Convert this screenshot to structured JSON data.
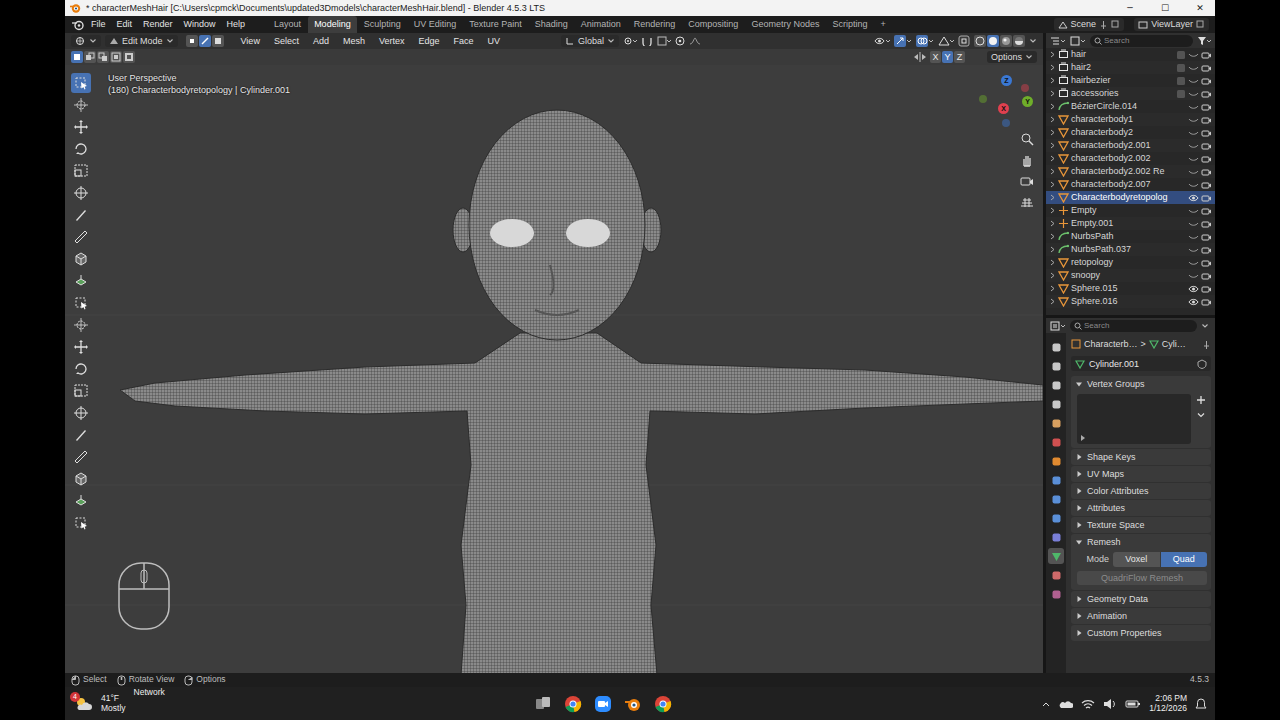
{
  "window": {
    "title": "* characterMeshHair [C:\\Users\\cpmck\\Documents\\updated3Dmodels\\characterMeshHair.blend] - Blender 4.5.3 LTS",
    "controls": [
      "─",
      "☐",
      "✕"
    ]
  },
  "menu": [
    "File",
    "Edit",
    "Render",
    "Window",
    "Help"
  ],
  "workspaces": [
    {
      "label": "Layout",
      "selected": false
    },
    {
      "label": "Modeling",
      "selected": true
    },
    {
      "label": "Sculpting",
      "selected": false
    },
    {
      "label": "UV Editing",
      "selected": false
    },
    {
      "label": "Texture Paint",
      "selected": false
    },
    {
      "label": "Shading",
      "selected": false
    },
    {
      "label": "Animation",
      "selected": false
    },
    {
      "label": "Rendering",
      "selected": false
    },
    {
      "label": "Compositing",
      "selected": false
    },
    {
      "label": "Geometry Nodes",
      "selected": false
    },
    {
      "label": "Scripting",
      "selected": false
    }
  ],
  "workspace_add": "+",
  "scene": "Scene",
  "view_layer": "ViewLayer",
  "header": {
    "mode": "Edit Mode",
    "select_modes": [
      {
        "selected": false
      },
      {
        "selected": true
      },
      {
        "selected": false
      }
    ],
    "menus": [
      "View",
      "Select",
      "Add",
      "Mesh",
      "Vertex",
      "Edge",
      "Face",
      "UV"
    ],
    "orientation": "Global",
    "shading": [
      {
        "selected": false
      },
      {
        "selected": true
      },
      {
        "selected": false
      },
      {
        "selected": false
      }
    ]
  },
  "tool_header": {
    "box_modes": [
      {
        "selected": true
      },
      {
        "selected": false
      },
      {
        "selected": false
      },
      {
        "selected": false
      },
      {
        "selected": false
      }
    ],
    "mirror": [
      {
        "label": "X",
        "selected": false
      },
      {
        "label": "Y",
        "selected": true
      },
      {
        "label": "Z",
        "selected": false
      }
    ],
    "options": "Options"
  },
  "toolbar": {
    "tools": [
      {
        "selected": true
      },
      {
        "selected": false
      },
      {
        "selected": false
      },
      {
        "selected": false
      },
      {
        "selected": false
      },
      {
        "selected": false
      },
      {
        "selected": false
      },
      {
        "selected": false
      },
      {
        "selected": false
      },
      {
        "selected": false
      },
      {
        "selected": false
      },
      {
        "selected": false
      },
      {
        "selected": false
      },
      {
        "selected": false
      },
      {
        "selected": false
      },
      {
        "selected": false
      },
      {
        "selected": false
      },
      {
        "selected": false
      },
      {
        "selected": false
      },
      {
        "selected": false
      },
      {
        "selected": false
      }
    ]
  },
  "viewport": {
    "view_name": "User Perspective",
    "object_info": "(180) Characterbodyretopology | Cylinder.001",
    "axes": [
      {
        "label": "X",
        "color": "#e0404f"
      },
      {
        "label": "Y",
        "color": "#6fae2a"
      },
      {
        "label": "Z",
        "color": "#3a78d4"
      }
    ]
  },
  "outliner": {
    "search_placeholder": "Search",
    "items": [
      {
        "name": "hair",
        "kind": "collection",
        "included": false,
        "visible": false,
        "selected": false
      },
      {
        "name": "hair2",
        "kind": "collection",
        "included": false,
        "visible": false,
        "selected": false
      },
      {
        "name": "hairbezier",
        "kind": "collection",
        "included": false,
        "visible": false,
        "selected": false
      },
      {
        "name": "accessories",
        "kind": "collection",
        "included": false,
        "visible": false,
        "selected": false
      },
      {
        "name": "BézierCircle.014",
        "kind": "curve",
        "visible": false,
        "selected": false
      },
      {
        "name": "characterbody1",
        "kind": "mesh",
        "visible": false,
        "selected": false
      },
      {
        "name": "characterbody2",
        "kind": "mesh",
        "visible": false,
        "selected": false
      },
      {
        "name": "characterbody2.001",
        "kind": "mesh",
        "visible": false,
        "selected": false
      },
      {
        "name": "characterbody2.002",
        "kind": "mesh",
        "visible": false,
        "selected": false
      },
      {
        "name": "characterbody2.002 Re",
        "kind": "mesh",
        "visible": false,
        "selected": false
      },
      {
        "name": "characterbody2.007",
        "kind": "mesh",
        "visible": false,
        "selected": false
      },
      {
        "name": "Characterbodyretopolog",
        "kind": "mesh",
        "visible": true,
        "selected": true
      },
      {
        "name": "Empty",
        "kind": "empty",
        "visible": false,
        "selected": false
      },
      {
        "name": "Empty.001",
        "kind": "empty",
        "visible": false,
        "selected": false
      },
      {
        "name": "NurbsPath",
        "kind": "curve",
        "visible": false,
        "selected": false
      },
      {
        "name": "NurbsPath.037",
        "kind": "curve",
        "visible": false,
        "selected": false
      },
      {
        "name": "retopology",
        "kind": "mesh",
        "visible": false,
        "selected": false
      },
      {
        "name": "snoopy",
        "kind": "mesh",
        "visible": false,
        "selected": false
      },
      {
        "name": "Sphere.015",
        "kind": "mesh",
        "visible": true,
        "selected": false
      },
      {
        "name": "Sphere.016",
        "kind": "mesh",
        "visible": true,
        "selected": false
      }
    ]
  },
  "properties": {
    "search_placeholder": "Search",
    "tabs": [
      {
        "selected": false
      },
      {
        "selected": false
      },
      {
        "selected": false
      },
      {
        "selected": false
      },
      {
        "selected": false
      },
      {
        "selected": false
      },
      {
        "selected": false
      },
      {
        "selected": false
      },
      {
        "selected": false
      },
      {
        "selected": false
      },
      {
        "selected": false
      },
      {
        "selected": true
      },
      {
        "selected": false
      },
      {
        "selected": false
      }
    ],
    "breadcrumb": [
      "Characterb…",
      "Cyli…"
    ],
    "breadcrumb_separator": ">",
    "data_name": "Cylinder.001",
    "panels": [
      {
        "title": "Vertex Groups",
        "expanded": true,
        "kind": "list"
      },
      {
        "title": "Shape Keys",
        "expanded": false,
        "kind": "plain"
      },
      {
        "title": "UV Maps",
        "expanded": false,
        "kind": "plain"
      },
      {
        "title": "Color Attributes",
        "expanded": false,
        "kind": "plain"
      },
      {
        "title": "Attributes",
        "expanded": false,
        "kind": "plain"
      },
      {
        "title": "Texture Space",
        "expanded": false,
        "kind": "plain"
      },
      {
        "title": "Remesh",
        "expanded": true,
        "kind": "remesh",
        "mode_label": "Mode",
        "modes": [
          {
            "label": "Voxel",
            "selected": false
          },
          {
            "label": "Quad",
            "selected": true
          }
        ],
        "button": "QuadriFlow Remesh",
        "button_disabled": true
      },
      {
        "title": "Geometry Data",
        "expanded": false,
        "kind": "plain"
      },
      {
        "title": "Animation",
        "expanded": false,
        "kind": "plain"
      },
      {
        "title": "Custom Properties",
        "expanded": false,
        "kind": "plain"
      }
    ]
  },
  "status_bar": {
    "hints": [
      "Select",
      "Rotate View",
      "Options"
    ],
    "version": "4.5.3"
  },
  "taskbar": {
    "badge": "4",
    "temperature": "41°F",
    "weather": "Mostly",
    "network": "Network",
    "time": "2:06 PM",
    "date": "1/12/2026"
  }
}
